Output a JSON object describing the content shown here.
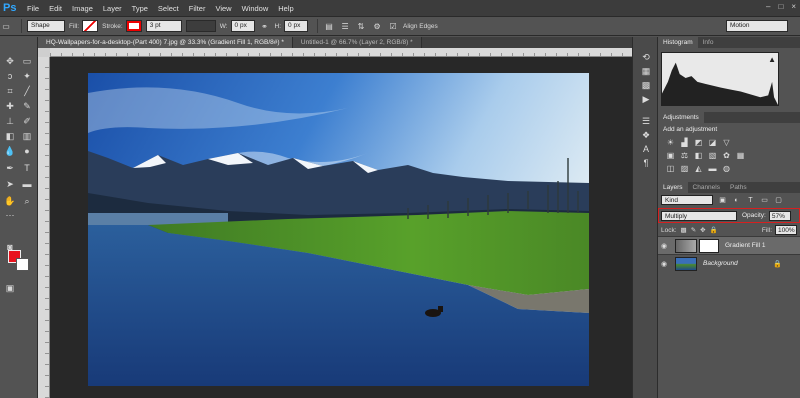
{
  "app": {
    "logo": "Ps"
  },
  "menu": [
    "File",
    "Edit",
    "Image",
    "Layer",
    "Type",
    "Select",
    "Filter",
    "View",
    "Window",
    "Help"
  ],
  "window_controls": [
    "–",
    "□",
    "×"
  ],
  "options_bar": {
    "shape_mode": "Shape",
    "fill_label": "Fill:",
    "stroke_label": "Stroke:",
    "stroke_size": "3 pt",
    "w_label": "W:",
    "w_value": "0 px",
    "h_label": "H:",
    "h_value": "0 px",
    "align_edges": "Align Edges",
    "workspace": "Motion"
  },
  "tabs": [
    "HQ-Wallpapers-for-a-desktop-(Part 400) 7.jpg @ 33.3% (Gradient Fill 1, RGB/8#) *",
    "Untitled-1 @ 66.7% (Layer 2, RGB/8) *"
  ],
  "panels": {
    "top_tabs": [
      "Histogram",
      "Info"
    ],
    "adjustments_tab": "Adjustments",
    "adjustments_title": "Add an adjustment",
    "layers_tabs": [
      "Layers",
      "Channels",
      "Paths"
    ],
    "kind_label": "Kind",
    "blend_mode": "Multiply",
    "opacity_label": "Opacity:",
    "opacity_value": "57%",
    "lock_label": "Lock:",
    "fill_label": "Fill:",
    "fill_value": "100%",
    "layers": [
      {
        "name": "Gradient Fill 1",
        "selected": true
      },
      {
        "name": "Background",
        "selected": false
      }
    ]
  },
  "colors": {
    "foreground": "#e8141e",
    "background": "#ffffff",
    "highlight": "#d62020"
  }
}
